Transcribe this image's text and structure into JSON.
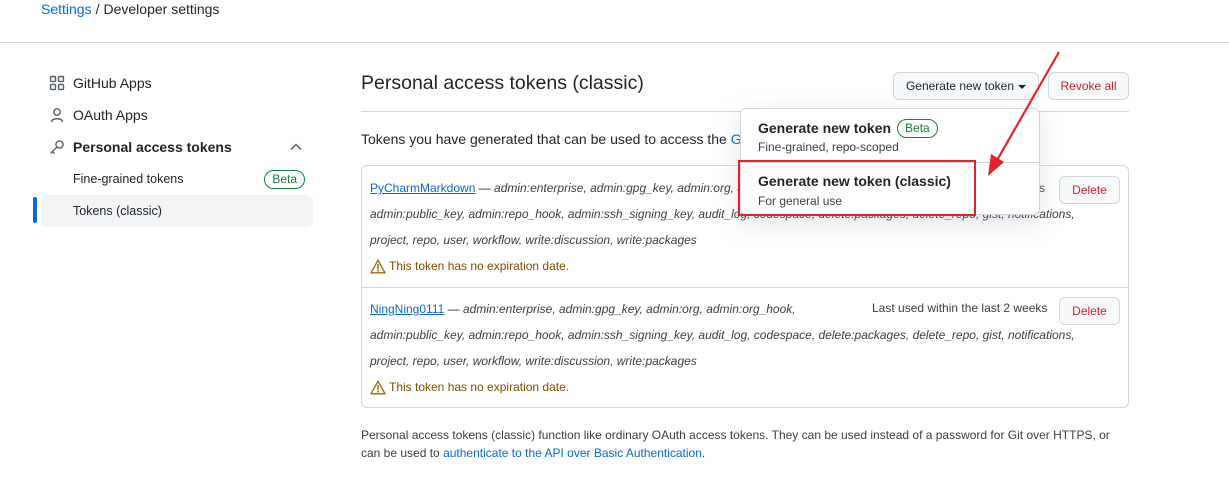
{
  "breadcrumb": {
    "root": "Settings",
    "separator": "/",
    "current": "Developer settings"
  },
  "sidebar": {
    "items": [
      {
        "label": "GitHub Apps",
        "icon": "apps-grid-icon"
      },
      {
        "label": "OAuth Apps",
        "icon": "person-icon"
      },
      {
        "label": "Personal access tokens",
        "icon": "key-icon",
        "expanded": true
      }
    ],
    "sub_items": [
      {
        "label": "Fine-grained tokens",
        "badge": "Beta"
      },
      {
        "label": "Tokens (classic)",
        "active": true
      }
    ]
  },
  "main": {
    "title": "Personal access tokens (classic)",
    "generate_button": "Generate new token",
    "revoke_button": "Revoke all",
    "intro_text": "Tokens you have generated that can be used to access the ",
    "intro_link": "Git"
  },
  "dropdown": {
    "items": [
      {
        "title": "Generate new token",
        "badge": "Beta",
        "subtitle": "Fine-grained, repo-scoped"
      },
      {
        "title": "Generate new token (classic)",
        "subtitle": "For general use",
        "highlighted": true
      }
    ]
  },
  "tokens": [
    {
      "name": "PyCharmMarkdown",
      "dash": " — ",
      "scopes_line1": "admin:enterprise, admin:gpg_key, admin:org, admin:org_hook,",
      "scopes_line2": "admin:public_key, admin:repo_hook, admin:ssh_signing_key, audit_log, codespace, delete:packages, delete_repo, gist, notifications,",
      "scopes_line3": "project, repo, user, workflow, write:discussion, write:packages",
      "warning": "This token has no expiration date.",
      "last_used": "s",
      "delete_label": "Delete"
    },
    {
      "name": "NingNing0111",
      "dash": " — ",
      "scopes_line1": "admin:enterprise, admin:gpg_key, admin:org, admin:org_hook,",
      "scopes_line2": "admin:public_key, admin:repo_hook, admin:ssh_signing_key, audit_log, codespace, delete:packages, delete_repo, gist, notifications,",
      "scopes_line3": "project, repo, user, workflow, write:discussion, write:packages",
      "warning": "This token has no expiration date.",
      "last_used": "Last used within the last 2 weeks",
      "delete_label": "Delete"
    }
  ],
  "footer": {
    "text": "Personal access tokens (classic) function like ordinary OAuth access tokens. They can be used instead of a password for Git over HTTPS, or can be used to ",
    "link": "authenticate to the API over Basic Authentication",
    "end": "."
  },
  "colors": {
    "link": "#0969da",
    "danger": "#cf222e",
    "success": "#1a7f37",
    "annotation": "#e5222c"
  }
}
